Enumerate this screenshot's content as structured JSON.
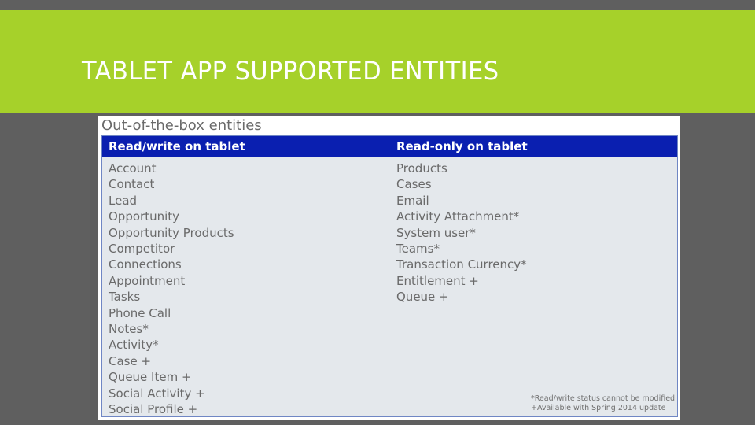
{
  "slide": {
    "title": "TABLET APP SUPPORTED ENTITIES",
    "colors": {
      "banner": "#a6d12a",
      "background": "#5f5f5f",
      "header": "#0a1fb0"
    }
  },
  "card": {
    "title": "Out-of-the-box entities",
    "columns": [
      {
        "header": "Read/write on tablet",
        "items": [
          "Account",
          "Contact",
          "Lead",
          "Opportunity",
          "Opportunity Products",
          "Competitor",
          "Connections",
          "Appointment",
          "Tasks",
          "Phone Call",
          "Notes*",
          "Activity*",
          "Case +",
          "Queue Item +",
          "Social Activity +",
          "Social Profile +"
        ]
      },
      {
        "header": "Read-only on tablet",
        "items": [
          "Products",
          "Cases",
          "Email",
          "Activity Attachment*",
          "System user*",
          "Teams*",
          "Transaction Currency*",
          "Entitlement +",
          "Queue +"
        ]
      }
    ],
    "footnotes": [
      "*Read/write status cannot be modified",
      "+Available with Spring 2014 update"
    ]
  }
}
